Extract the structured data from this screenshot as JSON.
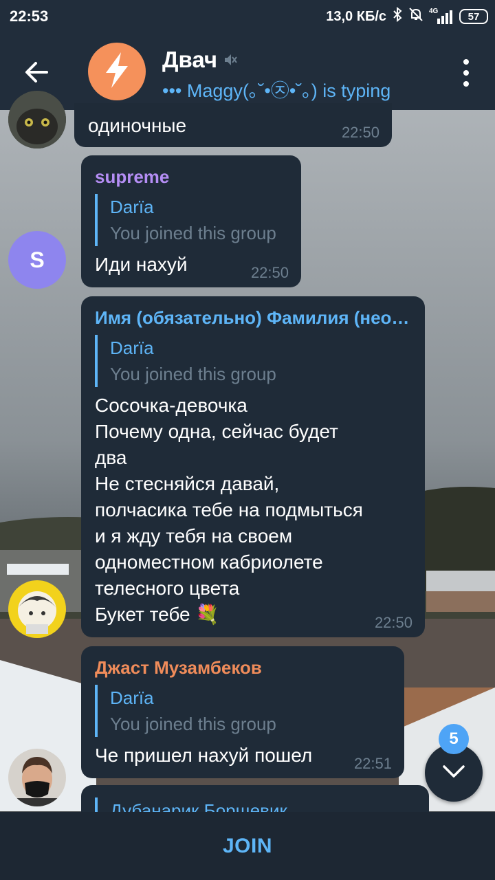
{
  "status_bar": {
    "time": "22:53",
    "network_speed": "13,0 КБ/с",
    "network_type": "4G",
    "battery": "57",
    "icons": [
      "bluetooth-icon",
      "mute-notifications-icon",
      "signal-icon",
      "battery-icon"
    ]
  },
  "header": {
    "title": "Двач",
    "status": "••• Maggy(｡˘•㉨•˘｡) is typing",
    "icons": [
      "back-arrow-icon",
      "lightning-icon",
      "muted-speaker-icon",
      "more-vertical-icon"
    ]
  },
  "messages": [
    {
      "text": "одиночные",
      "time": "22:50"
    },
    {
      "author": "supreme",
      "author_color": "#b58ef5",
      "avatar_letter": "S",
      "avatar_color": "#8e85ee",
      "reply_name": "Darïa",
      "reply_text": "You joined this group",
      "text": "Иди нахуй",
      "time": "22:50"
    },
    {
      "author": "Имя (обязательно) Фамилия (нео…",
      "author_color": "#5eb5f7",
      "reply_name": "Darïa",
      "reply_text": "You joined this group",
      "lines": [
        "Сосочка-девочка",
        "Почему одна, сейчас будет",
        "два",
        "Не стесняйся давай,",
        "полчасика тебе на подмыться",
        "и я жду тебя на своем",
        "одноместном кабриолете",
        "телесного цвета",
        "Букет тебе 💐"
      ],
      "time": "22:50"
    },
    {
      "author": "Джаст Музамбеков",
      "author_color": "#f08c5a",
      "reply_name": "Darïa",
      "reply_text": "You joined this group",
      "text": "Че пришел нахуй пошел",
      "time": "22:51"
    },
    {
      "reply_name": "Дубанарик Борщевик"
    }
  ],
  "scroll": {
    "unread_count": "5"
  },
  "join": {
    "label": "JOIN"
  },
  "colors": {
    "accent": "#5eb5f7",
    "bubble": "#1f2b38",
    "header": "#212d3b"
  }
}
